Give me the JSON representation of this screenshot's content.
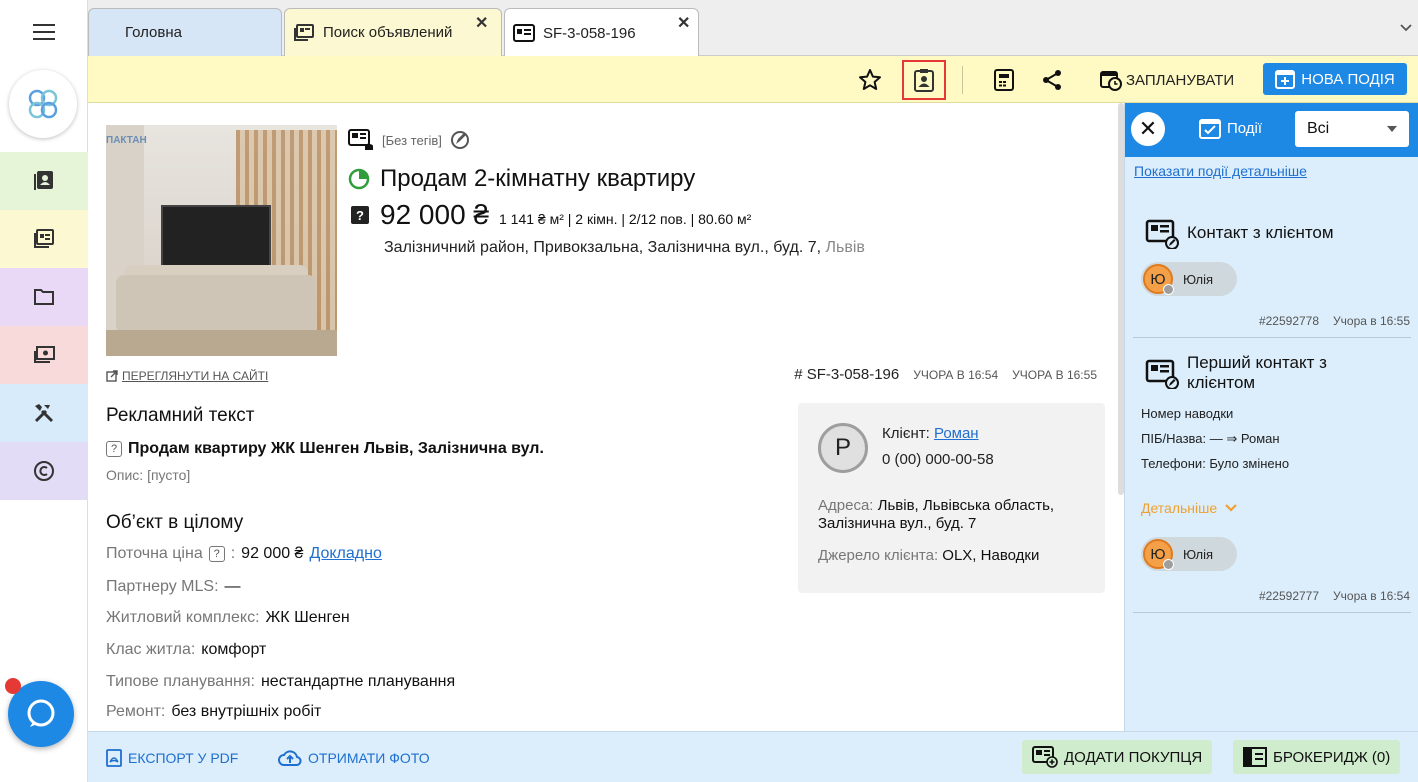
{
  "tabs": [
    {
      "label": "Головна"
    },
    {
      "label": "Поиск объявлений",
      "close": "✕"
    },
    {
      "label": "SF-3-058-196",
      "close": "✕"
    }
  ],
  "toolbar": {
    "plan_label": "ЗАПЛАНУВАТИ",
    "new_event_label": "НОВА ПОДІЯ"
  },
  "listing": {
    "photo_tag": "ПАКТАН",
    "tags": "[Без тегів]",
    "title": "Продам 2-кімнатну квартиру",
    "price": "92 000 ₴",
    "price_details": "1 141 ₴ м² | 2 кімн. | 2/12 пов. | 80.60 м²",
    "address": "Залізничний район, Привокзальна, Залізнична вул., буд. 7, ",
    "city": "Львів",
    "site_link": "ПЕРЕГЛЯНУТИ НА САЙТІ",
    "code": "# SF-3-058-196",
    "created": "УЧОРА В 16:54",
    "updated": "УЧОРА В 16:55"
  },
  "ad_section": {
    "heading": "Рекламний текст",
    "ad_title": "Продам квартиру ЖК Шенген Львів, Залізнична вул.",
    "description": "Опис: [пусто]"
  },
  "object_section": {
    "heading": "Об’єкт в цілому",
    "price_label": "Поточна ціна",
    "price_value": "92 000 ₴",
    "price_link": "Докладно",
    "rows": [
      {
        "label": "Партнеру MLS:",
        "value": "—"
      },
      {
        "label": "Житловий комплекс:",
        "value": "ЖК Шенген"
      },
      {
        "label": "Клас житла:",
        "value": "комфорт"
      },
      {
        "label": "Типове планування:",
        "value": "нестандартне планування"
      },
      {
        "label": "Ремонт:",
        "value": "без внутрішніх робіт"
      }
    ]
  },
  "client": {
    "initial": "Р",
    "label": "Клієнт: ",
    "name": "Роман",
    "phone": "0 (00) 000-00-58",
    "address_label": "Адреса: ",
    "address": "Львів, Львівська область, Залізнична вул., буд. 7",
    "source_label": "Джерело клієнта: ",
    "source": "OLX, Наводки"
  },
  "events": {
    "title": "Події",
    "filter": "Всі",
    "detail_link": "Показати події детальніше",
    "items": [
      {
        "title": "Контакт з клієнтом",
        "user_initial": "Ю",
        "user": "Юлія",
        "id": "#22592778",
        "time": "Учора в 16:55"
      },
      {
        "title": "Перший контакт з клієнтом",
        "lines": [
          "Номер наводки",
          "ПІБ/Назва: — ⇒ Роман",
          "Телефони: Було змінено"
        ],
        "more": "Детальніше",
        "user_initial": "Ю",
        "user": "Юлія",
        "id": "#22592777",
        "time": "Учора в 16:54"
      }
    ]
  },
  "bottom": {
    "export_pdf": "ЕКСПОРТ У PDF",
    "get_photo": "ОТРИМАТИ ФОТО",
    "add_buyer": "ДОДАТИ ПОКУПЦЯ",
    "brokerage": "БРОКЕРИДЖ (0)"
  },
  "colors": {
    "accent": "#1e88e5",
    "toolbar_bg": "#fff9c4",
    "panel_bg": "#dceefb",
    "highlight": "#e53935"
  }
}
